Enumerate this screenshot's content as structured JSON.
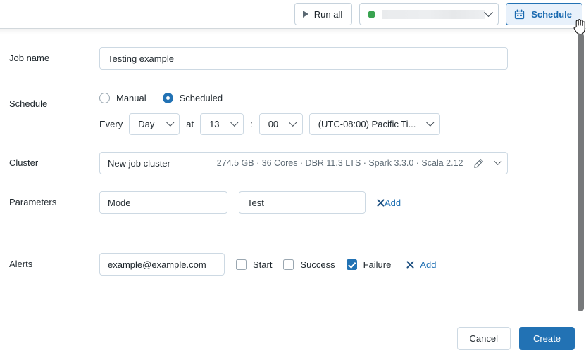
{
  "toolbar": {
    "run_all_label": "Run all",
    "run_all_icon": "play-icon",
    "cluster_selector": {
      "status_icon": "status-dot-green",
      "status_color": "#39a350",
      "value": "",
      "chevron_icon": "chevron-down-icon"
    },
    "schedule_label": "Schedule",
    "schedule_icon": "calendar-icon",
    "schedule_accent": "#2272b4"
  },
  "form": {
    "job_name": {
      "label": "Job name",
      "value": "Testing example",
      "placeholder": "Job name"
    },
    "schedule": {
      "label": "Schedule",
      "options": [
        {
          "label": "Manual",
          "selected": false
        },
        {
          "label": "Scheduled",
          "selected": true
        }
      ],
      "every_word": "Every",
      "at_word": "at",
      "colon": ":",
      "frequency": "Day",
      "hour": "13",
      "minute": "00",
      "timezone": "(UTC-08:00) Pacific Ti...",
      "chevron_icon": "chevron-down-icon"
    },
    "cluster": {
      "label": "Cluster",
      "name": "New job cluster",
      "specs": "274.5 GB · 36 Cores · DBR 11.3 LTS · Spark 3.3.0 · Scala 2.12",
      "edit_icon": "pencil-icon",
      "chevron_icon": "chevron-down-icon"
    },
    "parameters": {
      "label": "Parameters",
      "key": "Mode",
      "key_placeholder": "Key",
      "value": "Test",
      "value_placeholder": "Value",
      "add_label": "Add",
      "remove_icon": "close-x-icon"
    },
    "alerts": {
      "label": "Alerts",
      "email": "example@example.com",
      "email_placeholder": "Email",
      "checkboxes": [
        {
          "label": "Start",
          "checked": false
        },
        {
          "label": "Success",
          "checked": false
        },
        {
          "label": "Failure",
          "checked": true
        }
      ],
      "add_label": "Add",
      "remove_icon": "close-x-icon"
    }
  },
  "footer": {
    "cancel_label": "Cancel",
    "create_label": "Create",
    "primary_color": "#2272b4"
  }
}
